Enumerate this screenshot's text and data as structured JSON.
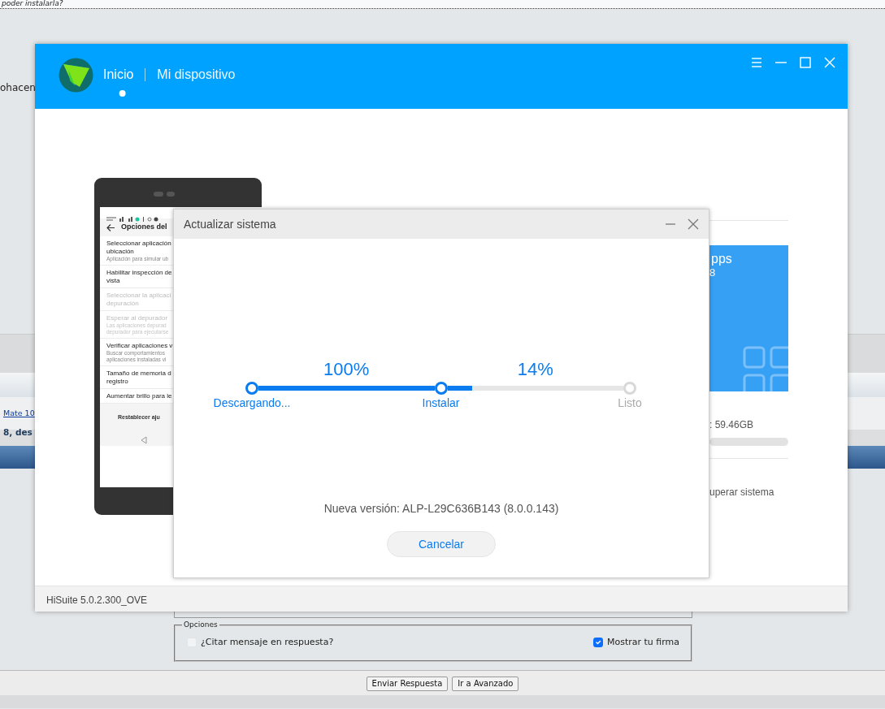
{
  "forum": {
    "top_text": "poder instalarla?",
    "left_text": "ohacen",
    "thread_link": "Mate 10",
    "thread_title": "8, des",
    "options": {
      "legend": "Opciones",
      "checkboxes": [
        {
          "label": "¿Citar mensaje en respuesta?",
          "checked": false,
          "disabled": true
        },
        {
          "label": "Mostrar tu firma",
          "checked": true,
          "disabled": false
        }
      ]
    },
    "buttons": [
      "Enviar Respuesta",
      "Ir a Avanzado"
    ]
  },
  "hisuite": {
    "tabs": [
      {
        "label": "Inicio",
        "selected": true
      },
      {
        "label": "Mi dispositivo",
        "selected": false
      }
    ],
    "phone": {
      "header": "Opciones del",
      "items": [
        {
          "lines": [
            "Seleccionar aplicación",
            "ubicación"
          ],
          "desc": [
            "Aplicación para simular ub"
          ],
          "disabled": false
        },
        {
          "lines": [
            "Habilitar inspección de",
            "vista"
          ],
          "disabled": false
        },
        {
          "lines": [
            "Seleccionar la aplicaci",
            "depuración"
          ],
          "disabled": true
        },
        {
          "lines": [
            "Esperar al depurador"
          ],
          "desc": [
            "Las aplicaciones depurad",
            "depurador para ejecutarse"
          ],
          "disabled": true
        },
        {
          "lines": [
            "Verificar aplicaciones v"
          ],
          "desc": [
            "Buscar comportamientos",
            "aplicaciones instaladas vi"
          ],
          "disabled": false
        },
        {
          "lines": [
            "Tamaño de memoria d",
            "registro"
          ],
          "disabled": false
        },
        {
          "lines": [
            "Aumentar brillo para le"
          ],
          "disabled": false
        }
      ],
      "footer": "Restablecer aju"
    },
    "apps_tile": {
      "title": "pps",
      "subtitle": "8"
    },
    "storage_text": ": 59.46GB",
    "recover_text": "uperar sistema",
    "version": "HiSuite 5.0.2.300_OVE"
  },
  "dialog": {
    "title": "Actualizar sistema",
    "segments": [
      {
        "percent": "100%",
        "level": 1
      },
      {
        "percent": "14%",
        "level": 0.14
      }
    ],
    "steps": [
      {
        "label": "Descargando...",
        "done": true
      },
      {
        "label": "Instalar",
        "done": true
      },
      {
        "label": "Listo",
        "done": false
      }
    ],
    "new_version": "Nueva versión: ALP-L29C636B143 (8.0.0.143)",
    "cancel": "Cancelar"
  }
}
